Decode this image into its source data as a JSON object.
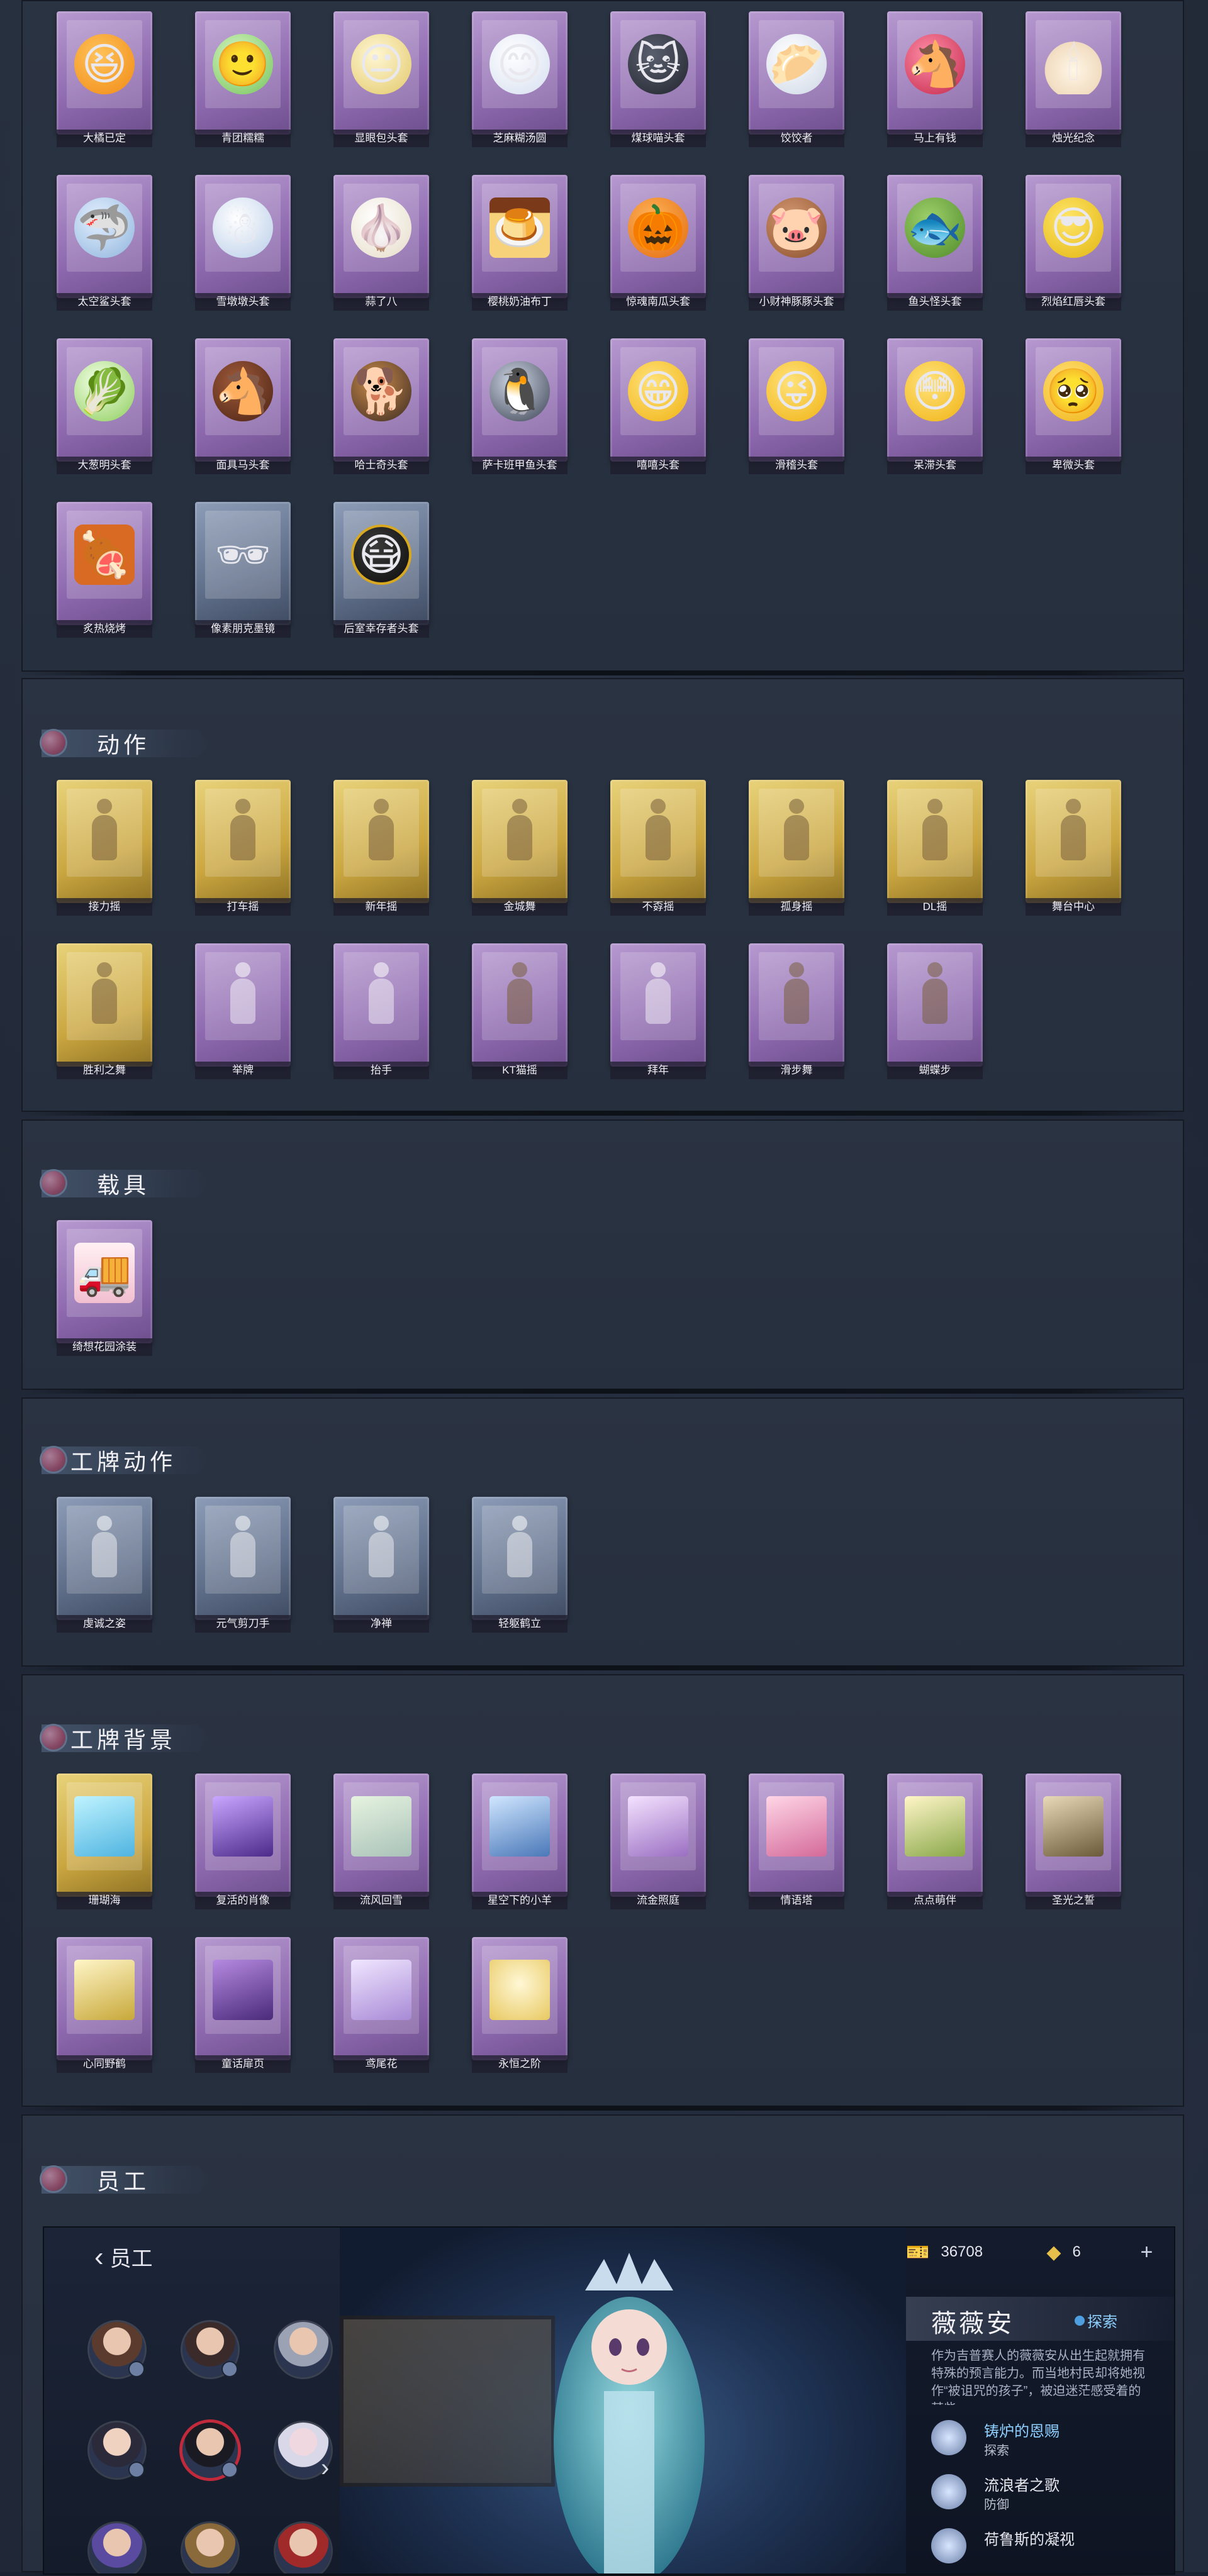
{
  "colors": {
    "background": "#1a2130",
    "panel": "#2a3342",
    "card_purple": "#9c7abf",
    "card_gold": "#d2b04a",
    "card_blue": "#6a7a95",
    "staff_accent": "#4f9fe0"
  },
  "accessories": {
    "items": [
      {
        "label": "大橘已定",
        "icon": "orange-head-icon"
      },
      {
        "label": "青团糯糯",
        "icon": "green-mochi-head-icon"
      },
      {
        "label": "显眼包头套",
        "icon": "bun-head-icon"
      },
      {
        "label": "芝麻糊汤圆",
        "icon": "tangyuan-head-icon"
      },
      {
        "label": "煤球喵头套",
        "icon": "black-cat-head-icon"
      },
      {
        "label": "饺饺者",
        "icon": "dumpling-head-icon"
      },
      {
        "label": "马上有钱",
        "icon": "horse-head-icon"
      },
      {
        "label": "烛光纪念",
        "icon": "candle-head-icon"
      },
      {
        "label": "太空鲨头套",
        "icon": "shark-head-icon"
      },
      {
        "label": "雪墩墩头套",
        "icon": "snow-head-icon"
      },
      {
        "label": "蒜了八",
        "icon": "garlic-head-icon"
      },
      {
        "label": "樱桃奶油布丁",
        "icon": "pudding-head-icon"
      },
      {
        "label": "惊魂南瓜头套",
        "icon": "pumpkin-head-icon"
      },
      {
        "label": "小财神豚豚头套",
        "icon": "pig-head-icon"
      },
      {
        "label": "鱼头怪头套",
        "icon": "fish-head-icon"
      },
      {
        "label": "烈焰红唇头套",
        "icon": "yellow-mouse-head-icon"
      },
      {
        "label": "大葱明头套",
        "icon": "scallion-head-icon"
      },
      {
        "label": "面具马头套",
        "icon": "horse-mask-head-icon"
      },
      {
        "label": "哈士奇头套",
        "icon": "dog-head-icon"
      },
      {
        "label": "萨卡班甲鱼头套",
        "icon": "penguin-fish-head-icon"
      },
      {
        "label": "嘻嘻头套",
        "icon": "grin-emoji-head-icon"
      },
      {
        "label": "滑稽头套",
        "icon": "funny-emoji-head-icon"
      },
      {
        "label": "呆滞头套",
        "icon": "dazed-emoji-head-icon"
      },
      {
        "label": "卑微头套",
        "icon": "humble-emoji-head-icon"
      },
      {
        "label": "炙热烧烤",
        "icon": "bbq-head-icon"
      },
      {
        "label": "像素朋克墨镜",
        "icon": "pixel-sunglasses-icon"
      },
      {
        "label": "后室幸存者头套",
        "icon": "gas-mask-head-icon"
      }
    ]
  },
  "emotes": {
    "title": "动作",
    "items": [
      {
        "label": "接力摇",
        "rarity": "gold"
      },
      {
        "label": "打车摇",
        "rarity": "gold"
      },
      {
        "label": "新年摇",
        "rarity": "gold"
      },
      {
        "label": "金城舞",
        "rarity": "gold"
      },
      {
        "label": "不孬摇",
        "rarity": "gold"
      },
      {
        "label": "孤身摇",
        "rarity": "gold"
      },
      {
        "label": "DL摇",
        "rarity": "gold"
      },
      {
        "label": "舞台中心",
        "rarity": "gold"
      },
      {
        "label": "胜利之舞",
        "rarity": "gold"
      },
      {
        "label": "举牌",
        "rarity": "purple"
      },
      {
        "label": "抬手",
        "rarity": "purple"
      },
      {
        "label": "KT猫摇",
        "rarity": "purple"
      },
      {
        "label": "拜年",
        "rarity": "purple"
      },
      {
        "label": "滑步舞",
        "rarity": "purple"
      },
      {
        "label": "蝴蝶步",
        "rarity": "purple"
      }
    ]
  },
  "vehicles": {
    "title": "载具",
    "items": [
      {
        "label": "绮想花园涂装",
        "icon": "truck-icon"
      }
    ]
  },
  "badge_emotes": {
    "title": "工牌动作",
    "items": [
      {
        "label": "虔诚之姿"
      },
      {
        "label": "元气剪刀手"
      },
      {
        "label": "净禅"
      },
      {
        "label": "轻躯鹤立"
      }
    ]
  },
  "badge_backgrounds": {
    "title": "工牌背景",
    "items": [
      {
        "label": "珊瑚海",
        "rarity": "gold"
      },
      {
        "label": "复活的肖像",
        "rarity": "purple"
      },
      {
        "label": "流风回雪",
        "rarity": "purple"
      },
      {
        "label": "星空下的小羊",
        "rarity": "purple"
      },
      {
        "label": "流金照庭",
        "rarity": "purple"
      },
      {
        "label": "情语塔",
        "rarity": "purple"
      },
      {
        "label": "点点萌伴",
        "rarity": "purple"
      },
      {
        "label": "圣光之誓",
        "rarity": "purple"
      },
      {
        "label": "心同野鹤",
        "rarity": "purple"
      },
      {
        "label": "童话扉页",
        "rarity": "purple"
      },
      {
        "label": "鸢尾花",
        "rarity": "purple"
      },
      {
        "label": "永恒之阶",
        "rarity": "purple"
      }
    ]
  },
  "staff": {
    "title": "员工",
    "screen": {
      "back_label": "员工",
      "currency_1": "36708",
      "currency_2": "6",
      "character_name": "薇薇安",
      "explore_label": "探索",
      "description": "作为吉普赛人的薇薇安从出生起就拥有特殊的预言能力。而当地村民却将她视作“被诅咒的孩子”，被迫迷茫感受着的某些……",
      "skills": [
        {
          "name": "铸炉的恩赐",
          "type": "探索"
        },
        {
          "name": "流浪者之歌",
          "type": "防御"
        },
        {
          "name": "荷鲁斯的凝视",
          "type": ""
        }
      ]
    }
  }
}
